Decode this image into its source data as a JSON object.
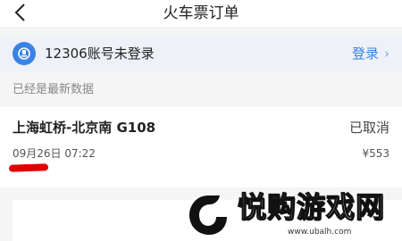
{
  "header": {
    "title": "火车票订单",
    "back_icon": "back-arrow-icon"
  },
  "account": {
    "icon": "railway-logo-icon",
    "text": "12306账号未登录",
    "login_label": "登录",
    "chevron": "›"
  },
  "status": {
    "text": "已经是最新数据"
  },
  "order": {
    "route": "上海虹桥-北京南 G108",
    "status": "已取消",
    "depart_time": "09月26日 07:22",
    "price": "¥553"
  },
  "watermark": {
    "brand": "悦购游戏网",
    "url": "www.ubalh.com"
  },
  "colors": {
    "accent": "#3a82e5",
    "redaction": "#e00000"
  }
}
